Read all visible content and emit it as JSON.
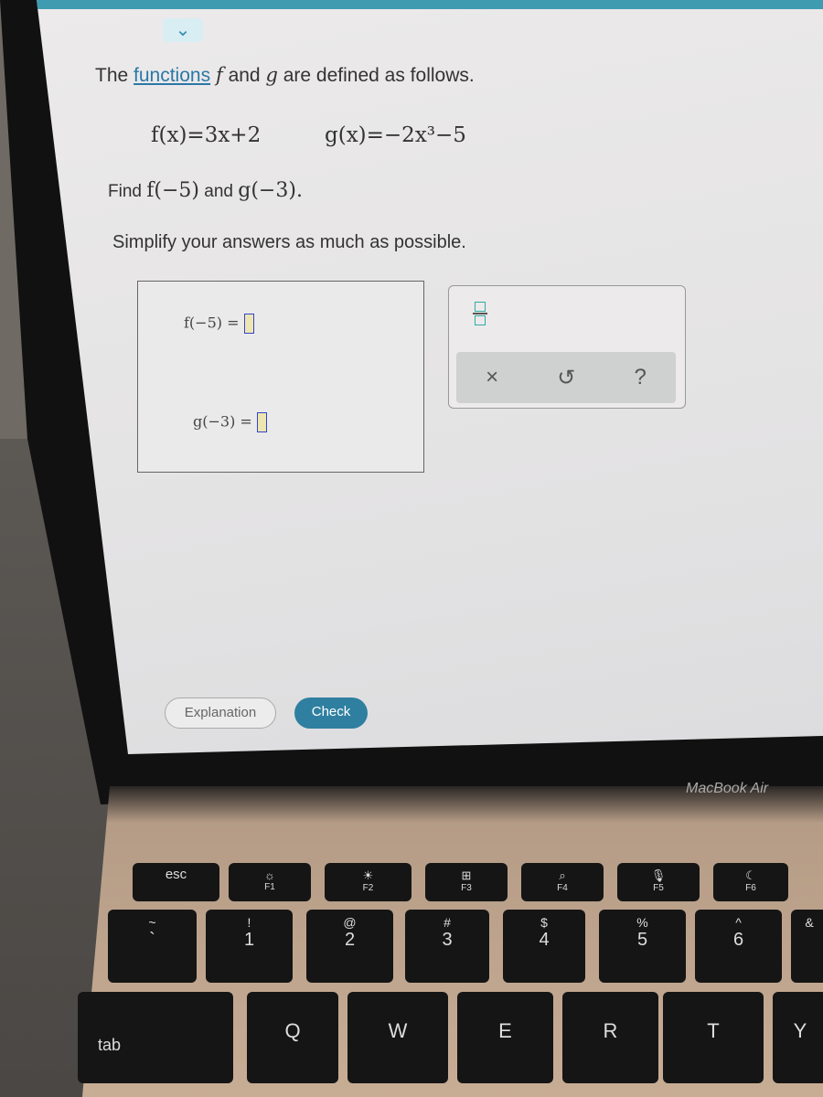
{
  "question": {
    "intro_pre": "The",
    "intro_link": "functions",
    "intro_f": "f",
    "intro_mid": "and",
    "intro_g": "g",
    "intro_post": "are defined as follows.",
    "f_def": "f(x)=3x+2",
    "g_def": "g(x)=−2x³−5",
    "find_label": "Find",
    "find_f": "f(−5)",
    "find_and": "and",
    "find_g": "g(−3).",
    "instruction": "Simplify your answers as much as possible."
  },
  "answers": {
    "f_label": "f(−5) =",
    "f_value": "",
    "g_label": "g(−3) =",
    "g_value": ""
  },
  "keypad": {
    "clear": "×",
    "undo": "↺",
    "help": "?"
  },
  "buttons": {
    "explanation": "Explanation",
    "check": "Check"
  },
  "laptop": {
    "brand": "MacBook Air"
  },
  "keyboard": {
    "row1": [
      {
        "t": "",
        "b": "esc"
      },
      {
        "t": "☼",
        "b": "F1"
      },
      {
        "t": "☀",
        "b": "F2"
      },
      {
        "t": "⊞",
        "b": "F3"
      },
      {
        "t": "⌕",
        "b": "F4"
      },
      {
        "t": "🎙",
        "b": "F5"
      },
      {
        "t": "☾",
        "b": "F6"
      }
    ],
    "row2": [
      {
        "t": "~",
        "b": "`"
      },
      {
        "t": "!",
        "b": "1"
      },
      {
        "t": "@",
        "b": "2"
      },
      {
        "t": "#",
        "b": "3"
      },
      {
        "t": "$",
        "b": "4"
      },
      {
        "t": "%",
        "b": "5"
      },
      {
        "t": "^",
        "b": "6"
      },
      {
        "t": "&",
        "b": ""
      }
    ],
    "row3": [
      {
        "t": "",
        "b": "tab"
      },
      {
        "t": "",
        "b": "Q"
      },
      {
        "t": "",
        "b": "W"
      },
      {
        "t": "",
        "b": "E"
      },
      {
        "t": "",
        "b": "R"
      },
      {
        "t": "",
        "b": "T"
      },
      {
        "t": "",
        "b": "Y"
      }
    ]
  },
  "colors": {
    "accent": "#3f9bb0",
    "link": "#2a78a8",
    "check_button": "#2f7fa0"
  }
}
